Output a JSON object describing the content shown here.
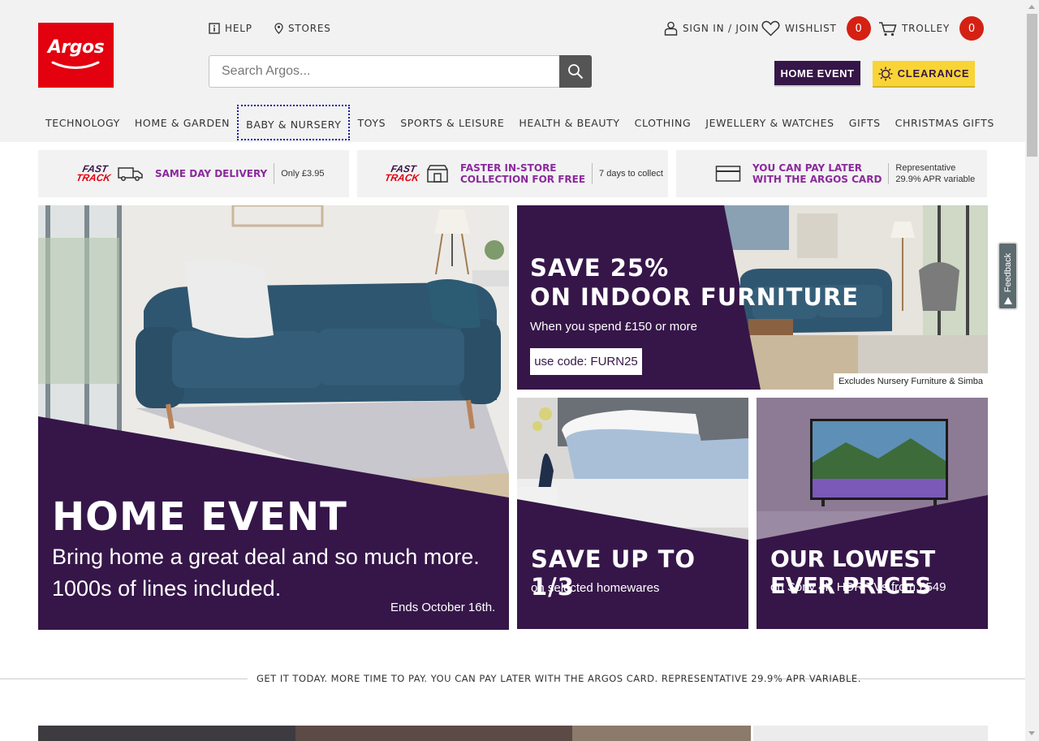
{
  "header": {
    "logo_text": "Argos",
    "help_label": "HELP",
    "stores_label": "STORES",
    "signin_label": "SIGN IN / JOIN",
    "wishlist_label": "WISHLIST",
    "wishlist_count": "0",
    "trolley_label": "TROLLEY",
    "trolley_count": "0",
    "search_placeholder": "Search Argos...",
    "home_event_button": "HOME EVENT",
    "clearance_button": "CLEARANCE"
  },
  "nav": {
    "items": [
      "TECHNOLOGY",
      "HOME & GARDEN",
      "BABY & NURSERY",
      "TOYS",
      "SPORTS & LEISURE",
      "HEALTH & BEAUTY",
      "CLOTHING",
      "JEWELLERY & WATCHES",
      "GIFTS",
      "CHRISTMAS GIFTS"
    ]
  },
  "info_strip": {
    "fast_track_line1": "FAST",
    "fast_track_line2": "TRACK",
    "delivery_title": "SAME DAY DELIVERY",
    "delivery_sub": "Only £3.95",
    "collection_title_1": "FASTER IN-STORE",
    "collection_title_2": "COLLECTION FOR FREE",
    "collection_sub": "7 days to collect",
    "card_title_1": "YOU CAN PAY LATER",
    "card_title_2": "WITH THE ARGOS CARD",
    "card_sub_1": "Representative",
    "card_sub_2": "29.9% APR variable"
  },
  "hero": {
    "title": "HOME EVENT",
    "line1": "Bring home a great deal and so much more.",
    "line2": "1000s of lines included.",
    "ends": "Ends October 16th."
  },
  "furniture_banner": {
    "title1": "SAVE 25%",
    "title2": "ON INDOOR FURNITURE",
    "sub": "When you spend £150 or more",
    "code": "use code: FURN25",
    "note": "Excludes Nursery Furniture & Simba"
  },
  "homewares_banner": {
    "title": "SAVE UP TO 1/3",
    "sub": "on selected homewares"
  },
  "tv_banner": {
    "title": "OUR LOWEST EVER PRICES",
    "sub": "on Sony 4K HDR TVs from £549"
  },
  "divider": {
    "text": "GET IT TODAY. MORE TIME TO PAY. YOU CAN PAY LATER WITH THE ARGOS CARD. REPRESENTATIVE 29.9% APR VARIABLE."
  },
  "feedback": {
    "label": "Feedback"
  },
  "colors": {
    "brand_red": "#e3000f",
    "brand_purple": "#361649",
    "clearance_yellow": "#f8d436",
    "badge_red": "#d42114"
  }
}
